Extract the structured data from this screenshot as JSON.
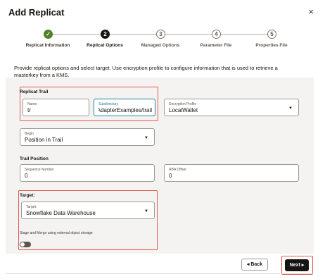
{
  "dialog": {
    "title": "Add Replicat",
    "close_symbol": "×"
  },
  "stepper": {
    "steps": [
      {
        "number": "✓",
        "label": "Replicat Information",
        "state": "done"
      },
      {
        "number": "2",
        "label": "Replicat Options",
        "state": "current"
      },
      {
        "number": "3",
        "label": "Managed Options",
        "state": "todo"
      },
      {
        "number": "4",
        "label": "Parameter File",
        "state": "todo"
      },
      {
        "number": "5",
        "label": "Properties File",
        "state": "todo"
      }
    ]
  },
  "description": "Provide replicat options and select target. Use encryption profile to configure information that is used to retrieve a masterkey from a KMS.",
  "replicat_trail": {
    "heading": "Replicat Trail",
    "name_label": "Name",
    "name_value": "tr",
    "subdirectory_label": "Subdirectory",
    "subdirectory_value": "AdapterExamples/trail/"
  },
  "encryption": {
    "label": "Encryption Profile",
    "value": "LocalWallet"
  },
  "begin": {
    "label": "Begin",
    "value": "Position in Trail"
  },
  "trail_position": {
    "heading": "Trail Position",
    "sequence_label": "Sequence Number",
    "sequence_value": "0",
    "rba_label": "RBA Offset",
    "rba_value": "0"
  },
  "target": {
    "heading": "Target:",
    "label": "Target:",
    "value": "Snowflake Data Warehouse",
    "stage_merge_label": "Stage and Merge using external object storage",
    "stage_merge_enabled": false
  },
  "footer": {
    "back_label": "◂  Back",
    "next_label": "Next  ▸"
  },
  "colors": {
    "highlight": "#e25a4a",
    "focus": "#227e9e",
    "done": "#508223"
  }
}
